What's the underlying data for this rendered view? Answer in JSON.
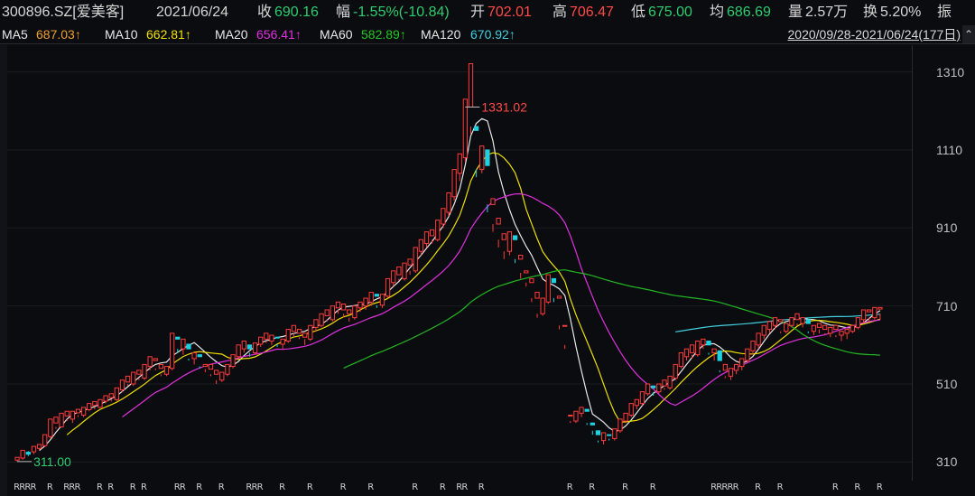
{
  "quote": {
    "code_name": "300896.SZ[爱美客]",
    "date": "2021/06/24",
    "close_label": "收",
    "close": "690.16",
    "change_label": "幅",
    "change": "-1.55%(-10.84)",
    "open_label": "开",
    "open": "702.01",
    "high_label": "高",
    "high": "706.47",
    "low_label": "低",
    "low": "675.00",
    "avg_label": "均",
    "avg": "686.69",
    "volume_label": "量",
    "volume": "2.57万",
    "turnover_label": "换",
    "turnover": "5.20%",
    "amplitude_label": "振"
  },
  "ma": {
    "ma5_label": "MA5",
    "ma5": "687.03↑",
    "ma10_label": "MA10",
    "ma10": "662.81↑",
    "ma20_label": "MA20",
    "ma20": "656.41↑",
    "ma60_label": "MA60",
    "ma60": "582.89↑",
    "ma120_label": "MA120",
    "ma120": "670.92↑",
    "range": "2020/09/28-2021/06/24(177日)",
    "range_btn": "⌃"
  },
  "annotations": {
    "max_label": "1331.02",
    "min_label": "311.00"
  },
  "colors": {
    "up": "#ff3b3b",
    "down": "#1fd0e0",
    "ma5": "#e8e8e8",
    "ma10": "#f0e000",
    "ma20": "#e030e0",
    "ma60": "#22b822",
    "ma120": "#40d0e0"
  },
  "chart_data": {
    "type": "candlestick",
    "ylim": [
      290,
      1360
    ],
    "yticks": [
      "1310",
      "1110",
      "910",
      "710",
      "510",
      "310"
    ],
    "y_tick_values": [
      1310,
      1110,
      910,
      710,
      510,
      310
    ],
    "candles": [
      [
        315,
        322,
        311,
        320
      ],
      [
        320,
        340,
        316,
        335
      ],
      [
        335,
        330,
        325,
        338
      ],
      [
        336,
        350,
        330,
        345
      ],
      [
        345,
        355,
        340,
        352
      ],
      [
        352,
        380,
        348,
        375
      ],
      [
        375,
        420,
        370,
        410
      ],
      [
        410,
        425,
        395,
        400
      ],
      [
        400,
        435,
        398,
        430
      ],
      [
        428,
        440,
        415,
        420
      ],
      [
        420,
        440,
        410,
        438
      ],
      [
        436,
        445,
        425,
        430
      ],
      [
        430,
        450,
        425,
        445
      ],
      [
        444,
        460,
        440,
        455
      ],
      [
        455,
        465,
        445,
        450
      ],
      [
        450,
        470,
        448,
        468
      ],
      [
        466,
        480,
        460,
        475
      ],
      [
        475,
        485,
        465,
        470
      ],
      [
        470,
        500,
        466,
        495
      ],
      [
        495,
        520,
        490,
        515
      ],
      [
        515,
        530,
        505,
        510
      ],
      [
        510,
        540,
        505,
        535
      ],
      [
        535,
        545,
        520,
        525
      ],
      [
        525,
        560,
        520,
        555
      ],
      [
        555,
        580,
        545,
        570
      ],
      [
        570,
        575,
        545,
        550
      ],
      [
        550,
        560,
        530,
        535
      ],
      [
        535,
        555,
        530,
        550
      ],
      [
        550,
        640,
        545,
        630
      ],
      [
        630,
        625,
        590,
        600
      ],
      [
        600,
        625,
        585,
        615
      ],
      [
        612,
        600,
        570,
        575
      ],
      [
        575,
        590,
        560,
        585
      ],
      [
        585,
        580,
        550,
        555
      ],
      [
        555,
        560,
        540,
        548
      ],
      [
        548,
        560,
        530,
        535
      ],
      [
        535,
        545,
        510,
        520
      ],
      [
        520,
        540,
        515,
        535
      ],
      [
        535,
        560,
        530,
        555
      ],
      [
        555,
        585,
        550,
        580
      ],
      [
        580,
        610,
        575,
        600
      ],
      [
        600,
        620,
        590,
        610
      ],
      [
        610,
        600,
        580,
        590
      ],
      [
        590,
        615,
        585,
        612
      ],
      [
        612,
        630,
        605,
        625
      ],
      [
        625,
        640,
        615,
        620
      ],
      [
        620,
        635,
        610,
        630
      ],
      [
        630,
        628,
        605,
        612
      ],
      [
        612,
        625,
        600,
        620
      ],
      [
        620,
        650,
        615,
        645
      ],
      [
        645,
        660,
        630,
        640
      ],
      [
        640,
        650,
        625,
        630
      ],
      [
        630,
        640,
        610,
        625
      ],
      [
        625,
        660,
        620,
        655
      ],
      [
        655,
        675,
        645,
        660
      ],
      [
        660,
        690,
        655,
        685
      ],
      [
        685,
        700,
        670,
        675
      ],
      [
        675,
        710,
        670,
        705
      ],
      [
        705,
        720,
        690,
        700
      ],
      [
        700,
        715,
        680,
        690
      ],
      [
        690,
        700,
        670,
        680
      ],
      [
        680,
        710,
        675,
        705
      ],
      [
        705,
        720,
        695,
        710
      ],
      [
        710,
        730,
        700,
        720
      ],
      [
        720,
        745,
        710,
        740
      ],
      [
        740,
        735,
        705,
        712
      ],
      [
        712,
        740,
        705,
        735
      ],
      [
        735,
        780,
        730,
        770
      ],
      [
        770,
        800,
        760,
        790
      ],
      [
        790,
        810,
        775,
        780
      ],
      [
        780,
        820,
        775,
        815
      ],
      [
        815,
        830,
        790,
        800
      ],
      [
        800,
        860,
        795,
        850
      ],
      [
        850,
        880,
        840,
        870
      ],
      [
        870,
        900,
        860,
        890
      ],
      [
        890,
        905,
        870,
        880
      ],
      [
        880,
        930,
        875,
        920
      ],
      [
        920,
        960,
        910,
        950
      ],
      [
        950,
        1000,
        940,
        990
      ],
      [
        990,
        1060,
        980,
        1050
      ],
      [
        1050,
        1100,
        1030,
        1090
      ],
      [
        1090,
        1240,
        1080,
        1220
      ],
      [
        1220,
        1331,
        1150,
        1170
      ],
      [
        1170,
        1160,
        1040,
        1060
      ],
      [
        1060,
        1120,
        1050,
        1110
      ],
      [
        1110,
        1070,
        950,
        970
      ],
      [
        970,
        985,
        900,
        920
      ],
      [
        920,
        935,
        860,
        880
      ],
      [
        880,
        895,
        830,
        850
      ],
      [
        850,
        900,
        840,
        890
      ],
      [
        890,
        880,
        820,
        830
      ],
      [
        830,
        840,
        780,
        795
      ],
      [
        795,
        800,
        760,
        770
      ],
      [
        770,
        780,
        720,
        730
      ],
      [
        730,
        745,
        680,
        690
      ],
      [
        690,
        730,
        685,
        720
      ],
      [
        720,
        790,
        715,
        780
      ],
      [
        780,
        770,
        720,
        730
      ],
      [
        730,
        735,
        650,
        660
      ],
      [
        660,
        660,
        600,
        610
      ],
      [
        430,
        430,
        410,
        415
      ],
      [
        415,
        440,
        410,
        435
      ],
      [
        435,
        450,
        425,
        445
      ],
      [
        445,
        440,
        405,
        410
      ],
      [
        410,
        405,
        380,
        390
      ],
      [
        390,
        380,
        360,
        365
      ],
      [
        365,
        385,
        355,
        380
      ],
      [
        380,
        378,
        365,
        370
      ],
      [
        370,
        395,
        365,
        390
      ],
      [
        390,
        420,
        385,
        415
      ],
      [
        415,
        435,
        410,
        430
      ],
      [
        430,
        460,
        425,
        455
      ],
      [
        455,
        470,
        445,
        460
      ],
      [
        460,
        490,
        455,
        485
      ],
      [
        485,
        510,
        480,
        505
      ],
      [
        505,
        500,
        480,
        490
      ],
      [
        490,
        510,
        485,
        505
      ],
      [
        505,
        520,
        495,
        500
      ],
      [
        500,
        530,
        495,
        525
      ],
      [
        525,
        560,
        520,
        555
      ],
      [
        555,
        590,
        550,
        580
      ],
      [
        580,
        600,
        570,
        590
      ],
      [
        590,
        610,
        575,
        585
      ],
      [
        585,
        620,
        580,
        610
      ],
      [
        610,
        625,
        600,
        620
      ],
      [
        620,
        610,
        585,
        590
      ],
      [
        590,
        600,
        570,
        595
      ],
      [
        595,
        570,
        540,
        545
      ],
      [
        545,
        560,
        525,
        530
      ],
      [
        530,
        550,
        520,
        545
      ],
      [
        545,
        560,
        535,
        555
      ],
      [
        555,
        575,
        545,
        570
      ],
      [
        570,
        600,
        565,
        595
      ],
      [
        595,
        620,
        585,
        610
      ],
      [
        610,
        640,
        600,
        635
      ],
      [
        635,
        660,
        625,
        650
      ],
      [
        650,
        670,
        640,
        660
      ],
      [
        660,
        680,
        650,
        670
      ],
      [
        670,
        675,
        640,
        645
      ],
      [
        645,
        665,
        640,
        660
      ],
      [
        660,
        680,
        655,
        675
      ],
      [
        675,
        690,
        660,
        665
      ],
      [
        665,
        680,
        655,
        675
      ],
      [
        675,
        665,
        640,
        645
      ],
      [
        645,
        660,
        635,
        655
      ],
      [
        655,
        665,
        640,
        650
      ],
      [
        650,
        660,
        635,
        640
      ],
      [
        640,
        655,
        630,
        650
      ],
      [
        650,
        660,
        630,
        635
      ],
      [
        635,
        645,
        620,
        640
      ],
      [
        640,
        650,
        625,
        645
      ],
      [
        645,
        660,
        640,
        655
      ],
      [
        655,
        680,
        650,
        675
      ],
      [
        675,
        700,
        665,
        695
      ],
      [
        695,
        700,
        670,
        680
      ],
      [
        680,
        706,
        675,
        702
      ],
      [
        702,
        706,
        675,
        690
      ]
    ]
  }
}
